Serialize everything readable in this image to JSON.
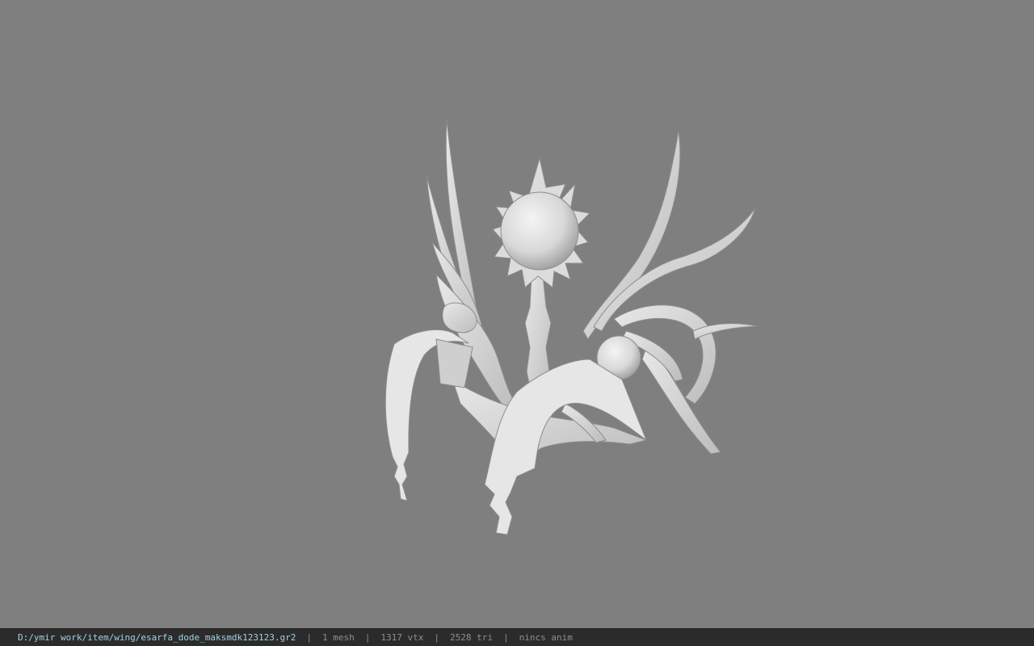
{
  "viewer": {
    "background_color": "#7f7f7f",
    "model_icon": "wing-model-icon"
  },
  "status_bar": {
    "file_path": "D:/ymir work/item/wing/esarfa_dode_maksmdk123123.gr2",
    "separator": "|",
    "mesh_count": "1 mesh",
    "vertex_count": "1317 vtx",
    "triangle_count": "2528 tri",
    "anim_status": "nincs anim",
    "path_color": "#9fd3e6",
    "text_color": "#8f8f8f"
  }
}
